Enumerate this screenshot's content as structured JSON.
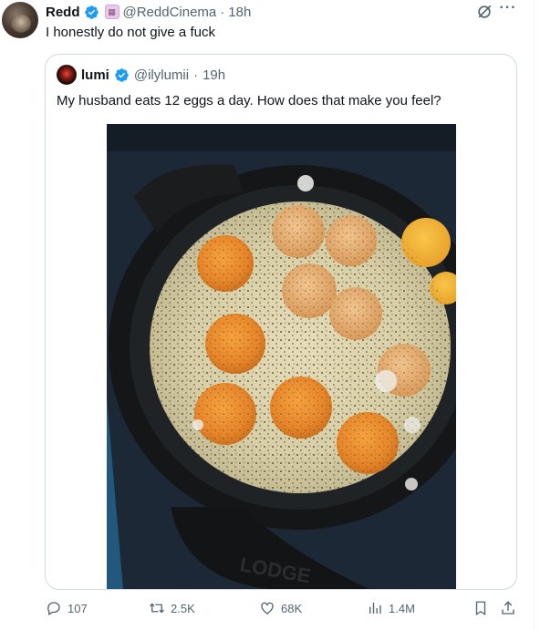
{
  "tweet": {
    "author_name": "Redd",
    "author_handle": "@ReddCinema",
    "time": "18h",
    "text": "I honestly do not give a fuck"
  },
  "quoted": {
    "author_name": "lumi",
    "author_handle": "@ilylumii",
    "time": "19h",
    "text": "My husband eats 12 eggs a day. How does that make you feel?",
    "pan_brand": "LODGE"
  },
  "actions": {
    "replies": "107",
    "reposts": "2.5K",
    "likes": "68K",
    "views": "1.4M"
  },
  "icons": {
    "verified": "verified-badge-icon",
    "affiliate": "affiliate-badge-icon",
    "grok": "grok-icon",
    "more": "more-dots-icon",
    "reply": "reply-icon",
    "repost": "repost-icon",
    "like": "heart-icon",
    "views": "views-chart-icon",
    "bookmark": "bookmark-icon",
    "share": "share-icon"
  },
  "colors": {
    "verified_blue": "#1d9bf0",
    "muted_text": "#536471",
    "border": "#cfd9de"
  }
}
